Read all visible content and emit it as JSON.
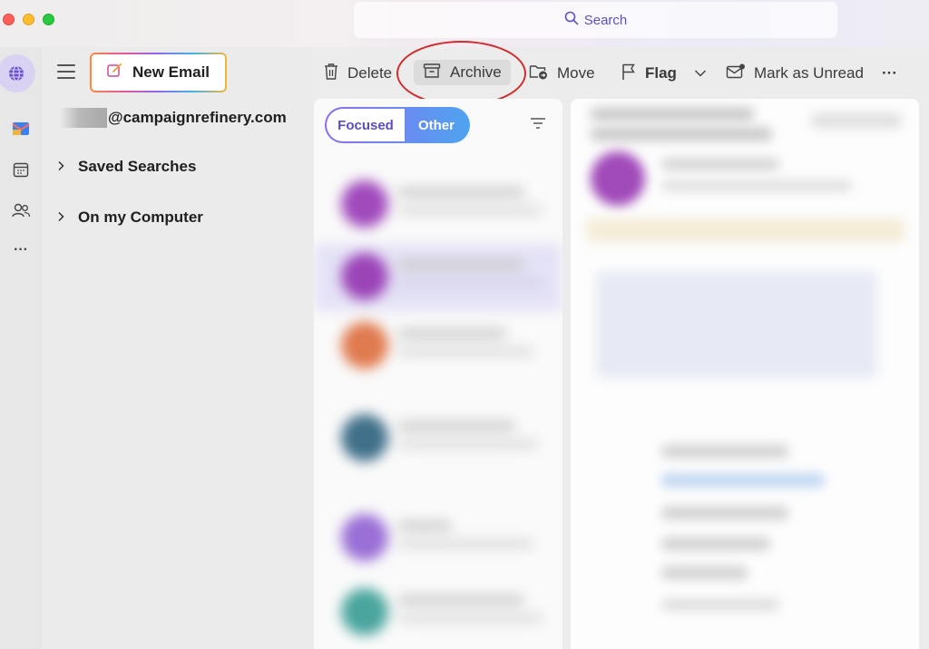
{
  "search": {
    "placeholder": "Search"
  },
  "new_email": {
    "label": "New Email"
  },
  "account": {
    "email": "@campaignrefinery.com"
  },
  "folders": [
    {
      "label": "Saved Searches"
    },
    {
      "label": "On my Computer"
    }
  ],
  "toolbar": {
    "delete": "Delete",
    "archive": "Archive",
    "move": "Move",
    "flag": "Flag",
    "mark_unread": "Mark as Unread",
    "more": "···"
  },
  "pivot": {
    "focused": "Focused",
    "other": "Other"
  },
  "rail": {
    "more": "···"
  },
  "colors": {
    "accent": "#5b50c9",
    "highlight_ring": "#d42a2a",
    "avatars": [
      "#a04abc",
      "#9b44b8",
      "#e07a4f",
      "#40708a",
      "#9a6fd6",
      "#4aa59e"
    ]
  }
}
